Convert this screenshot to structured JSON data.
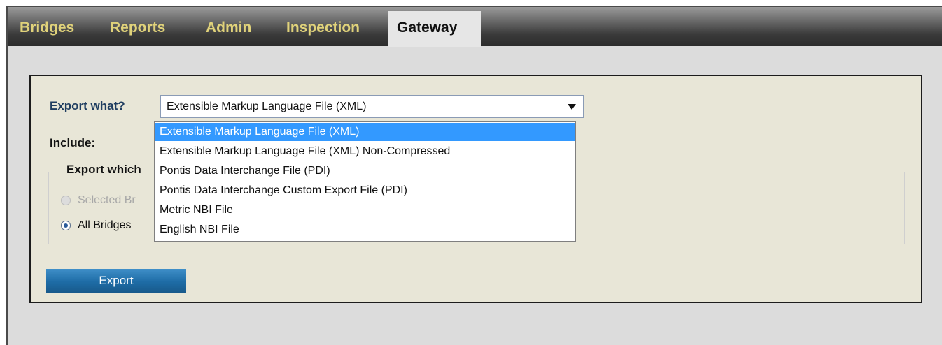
{
  "nav": {
    "items": [
      {
        "label": "Bridges"
      },
      {
        "label": "Reports"
      },
      {
        "label": "Admin"
      },
      {
        "label": "Inspection"
      },
      {
        "label": "Gateway",
        "active": true
      }
    ]
  },
  "form": {
    "export_what_label": "Export what?",
    "export_what_value": "Extensible Markup Language File (XML)",
    "include_label": "Include:",
    "export_which_label": "Export which",
    "radio_options": [
      {
        "label": "Selected Br",
        "checked": false,
        "disabled": true
      },
      {
        "label": "All Bridges",
        "checked": true,
        "disabled": false
      }
    ],
    "export_button": "Export"
  },
  "dropdown": {
    "options": [
      {
        "label": "Extensible Markup Language File (XML)",
        "selected": true
      },
      {
        "label": "Extensible Markup Language File (XML) Non-Compressed",
        "selected": false
      },
      {
        "label": "Pontis Data Interchange File (PDI)",
        "selected": false
      },
      {
        "label": "Pontis Data Interchange Custom Export File (PDI)",
        "selected": false
      },
      {
        "label": "Metric NBI File",
        "selected": false
      },
      {
        "label": "English NBI File",
        "selected": false
      }
    ]
  },
  "colors": {
    "nav_text": "#e0d27a",
    "label_text": "#1f3d60",
    "panel_bg": "#e8e6d7",
    "selection_bg": "#3399ff",
    "button_bg": "#1e6ca6"
  }
}
